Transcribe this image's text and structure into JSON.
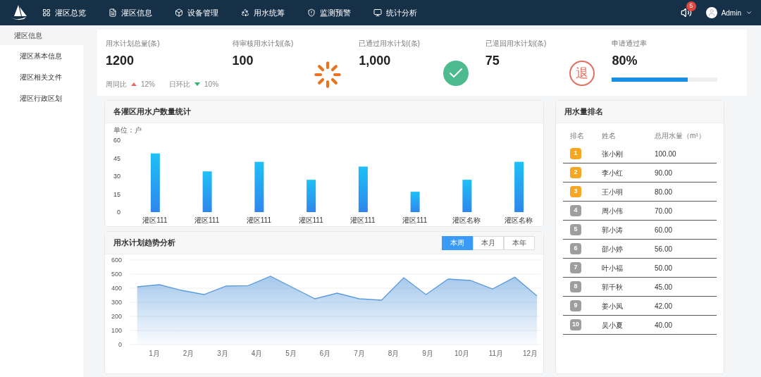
{
  "nav": {
    "items": [
      {
        "label": "灌区总览"
      },
      {
        "label": "灌区信息"
      },
      {
        "label": "设备管理"
      },
      {
        "label": "用水统筹"
      },
      {
        "label": "监测预警"
      },
      {
        "label": "统计分析"
      }
    ],
    "notifications": "5",
    "user": "Admin"
  },
  "sidebar": {
    "title": "灌区信息",
    "items": [
      "灌区基本信息",
      "灌区相关文件",
      "灌区行政区划"
    ]
  },
  "stats": [
    {
      "label": "用水计划总量(条)",
      "value": "1200",
      "trends": [
        {
          "label": "周同比",
          "kind": "up",
          "value": "12%"
        },
        {
          "label": "日环比",
          "kind": "down",
          "value": "10%"
        }
      ]
    },
    {
      "label": "待审核用水计划(条)",
      "value": "100",
      "kind": "spinner"
    },
    {
      "label": "已通过用水计划(条)",
      "value": "1,000",
      "kind": "check"
    },
    {
      "label": "已退回用水计划(条)",
      "value": "75",
      "kind": "stamp",
      "stamp": "退"
    },
    {
      "label": "申请通过率",
      "value": "80%",
      "level": 0.72
    }
  ],
  "bar_panel": {
    "title": "各灌区用水户数量统计",
    "unit": "单位：户",
    "chart_data": {
      "type": "bar",
      "categories": [
        "灌区111",
        "灌区111",
        "灌区111",
        "灌区111",
        "灌区111",
        "灌区111",
        "灌区名称",
        "灌区名称"
      ],
      "values": [
        49,
        34,
        42,
        27,
        38,
        17,
        27,
        42
      ],
      "ylim": [
        0,
        60
      ],
      "yticks": [
        0,
        15,
        30,
        45,
        60
      ]
    }
  },
  "line_panel": {
    "title": "用水计划趋势分析",
    "tabs": [
      {
        "label": "本周",
        "selected": true
      },
      {
        "label": "本月",
        "selected": false
      },
      {
        "label": "本年",
        "selected": false
      }
    ],
    "chart_data": {
      "type": "area",
      "x": [
        0.5,
        1.15,
        1.8,
        2.45,
        3.1,
        3.75,
        4.4,
        5.05,
        5.7,
        6.35,
        7.0,
        7.65,
        8.3,
        8.95,
        9.6,
        10.25,
        10.9,
        11.55,
        12.2
      ],
      "grid": true,
      "series": [
        {
          "color": "#5b9bdc",
          "values": [
            410,
            425,
            385,
            355,
            415,
            418,
            485,
            405,
            325,
            365,
            325,
            315,
            475,
            355,
            465,
            455,
            395,
            478,
            345
          ]
        }
      ],
      "xlim": [
        0.3,
        12.3
      ],
      "ylim": [
        0,
        600
      ],
      "yticks": [
        0,
        100,
        200,
        300,
        400,
        500,
        600
      ],
      "xticks": [
        {
          "value": 1,
          "label": "1月"
        },
        {
          "value": 2,
          "label": "2月"
        },
        {
          "value": 3,
          "label": "3月"
        },
        {
          "value": 4,
          "label": "4月"
        },
        {
          "value": 5,
          "label": "5月"
        },
        {
          "value": 6,
          "label": "6月"
        },
        {
          "value": 7,
          "label": "7月"
        },
        {
          "value": 8,
          "label": "8月"
        },
        {
          "value": 9,
          "label": "9月"
        },
        {
          "value": 10,
          "label": "10月"
        },
        {
          "value": 11,
          "label": "11月"
        },
        {
          "value": 12,
          "label": "12月"
        }
      ]
    }
  },
  "ranking": {
    "title": "用水量排名",
    "columns": [
      "排名",
      "姓名",
      "总用水量（m³）"
    ],
    "rows": [
      {
        "rank": "1",
        "name": "张小刚",
        "amount": "100.00",
        "color": "#f5a623"
      },
      {
        "rank": "2",
        "name": "李小红",
        "amount": "90.00",
        "color": "#f5a623"
      },
      {
        "rank": "3",
        "name": "王小明",
        "amount": "80.00",
        "color": "#f5a623"
      },
      {
        "rank": "4",
        "name": "周小伟",
        "amount": "70.00",
        "color": "#9e9e9e"
      },
      {
        "rank": "5",
        "name": "郭小涛",
        "amount": "60.00",
        "color": "#9e9e9e"
      },
      {
        "rank": "6",
        "name": "邵小婷",
        "amount": "56.00",
        "color": "#9e9e9e"
      },
      {
        "rank": "7",
        "name": "叶小福",
        "amount": "50.00",
        "color": "#9e9e9e"
      },
      {
        "rank": "8",
        "name": "郭千秋",
        "amount": "45.00",
        "color": "#9e9e9e"
      },
      {
        "rank": "9",
        "name": "姜小凤",
        "amount": "42.00",
        "color": "#9e9e9e"
      },
      {
        "rank": "10",
        "name": "吴小夏",
        "amount": "40.00",
        "color": "#9e9e9e"
      }
    ]
  }
}
